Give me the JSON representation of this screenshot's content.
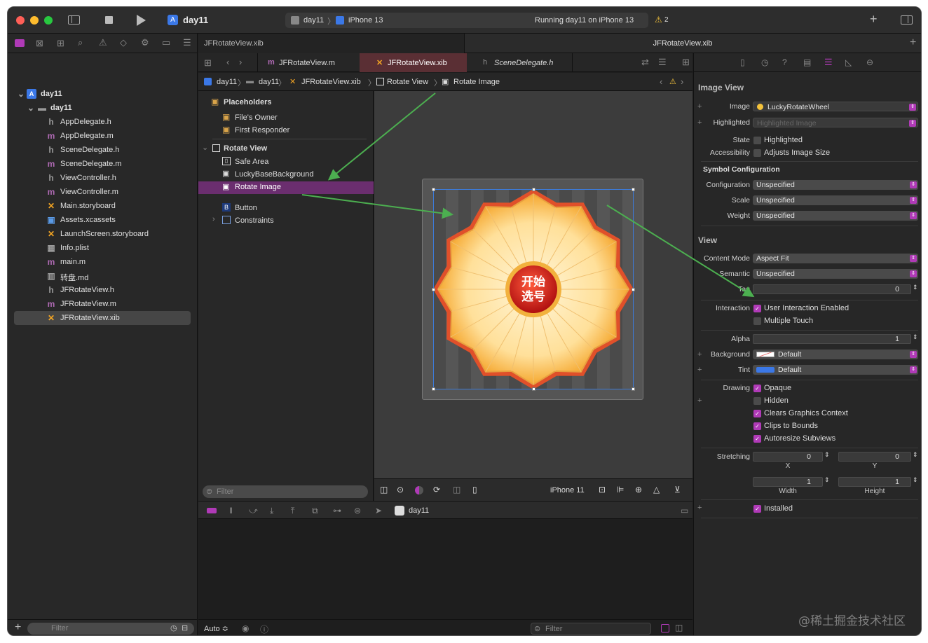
{
  "toolbar": {
    "project": "day11",
    "scheme_target": "day11",
    "device": "iPhone 13",
    "status": "Running day11 on iPhone 13",
    "warnings": "2"
  },
  "window_tabs": [
    "JFRotateView.xib",
    "JFRotateView.xib"
  ],
  "navigator": {
    "root": "day11",
    "group": "day11",
    "files": [
      {
        "icon": "h",
        "name": "AppDelegate.h"
      },
      {
        "icon": "m",
        "name": "AppDelegate.m"
      },
      {
        "icon": "h",
        "name": "SceneDelegate.h"
      },
      {
        "icon": "m",
        "name": "SceneDelegate.m"
      },
      {
        "icon": "h",
        "name": "ViewController.h"
      },
      {
        "icon": "m",
        "name": "ViewController.m"
      },
      {
        "icon": "xib",
        "name": "Main.storyboard"
      },
      {
        "icon": "assets",
        "name": "Assets.xcassets"
      },
      {
        "icon": "xib",
        "name": "LaunchScreen.storyboard"
      },
      {
        "icon": "plist",
        "name": "Info.plist"
      },
      {
        "icon": "m",
        "name": "main.m"
      },
      {
        "icon": "md",
        "name": "转盘.md"
      },
      {
        "icon": "h",
        "name": "JFRotateView.h"
      },
      {
        "icon": "m",
        "name": "JFRotateView.m"
      },
      {
        "icon": "xib",
        "name": "JFRotateView.xib"
      }
    ],
    "filter_placeholder": "Filter"
  },
  "editor_tabs": [
    "JFRotateView.m",
    "JFRotateView.xib",
    "SceneDelegate.h"
  ],
  "breadcrumb": [
    "day11",
    "day11",
    "JFRotateView.xib",
    "Rotate View",
    "Rotate Image"
  ],
  "outline": {
    "placeholders": "Placeholders",
    "owner": "File's Owner",
    "responder": "First Responder",
    "rotate_view": "Rotate View",
    "items": [
      "Safe Area",
      "LuckyBaseBackground",
      "Rotate Image",
      "Button",
      "Constraints"
    ],
    "filter_placeholder": "Filter"
  },
  "canvas": {
    "wheel_text_1": "开始",
    "wheel_text_2": "选号",
    "device_label": "iPhone 11"
  },
  "debug_bar": {
    "target": "day11"
  },
  "console": {
    "mode": "Auto ≎",
    "filter_placeholder": "Filter"
  },
  "inspector": {
    "image_view_title": "Image View",
    "image_label": "Image",
    "image_value": "LuckyRotateWheel",
    "highlighted_label": "Highlighted",
    "highlighted_placeholder": "Highlighted Image",
    "state_label": "State",
    "state_value": "Highlighted",
    "accessibility_label": "Accessibility",
    "accessibility_value": "Adjusts Image Size",
    "symbol_title": "Symbol Configuration",
    "configuration_label": "Configuration",
    "configuration_value": "Unspecified",
    "scale_label": "Scale",
    "scale_value": "Unspecified",
    "weight_label": "Weight",
    "weight_value": "Unspecified",
    "view_title": "View",
    "content_mode_label": "Content Mode",
    "content_mode_value": "Aspect Fit",
    "semantic_label": "Semantic",
    "semantic_value": "Unspecified",
    "tag_label": "Tag",
    "tag_value": "0",
    "interaction_label": "Interaction",
    "user_interaction": "User Interaction Enabled",
    "multiple_touch": "Multiple Touch",
    "alpha_label": "Alpha",
    "alpha_value": "1",
    "background_label": "Background",
    "background_value": "Default",
    "tint_label": "Tint",
    "tint_value": "Default",
    "drawing_label": "Drawing",
    "opaque": "Opaque",
    "hidden": "Hidden",
    "clears": "Clears Graphics Context",
    "clips": "Clips to Bounds",
    "autoresize": "Autoresize Subviews",
    "stretching_label": "Stretching",
    "stretch_x_value": "0",
    "stretch_y_value": "0",
    "stretch_w_value": "1",
    "stretch_h_value": "1",
    "x_label": "X",
    "y_label": "Y",
    "width_label": "Width",
    "height_label": "Height",
    "installed": "Installed"
  },
  "watermark": "@稀土掘金技术社区",
  "colors": {
    "accent": "#b03ab7",
    "selection": "#6b2e6f",
    "arrow": "#4caf50"
  }
}
